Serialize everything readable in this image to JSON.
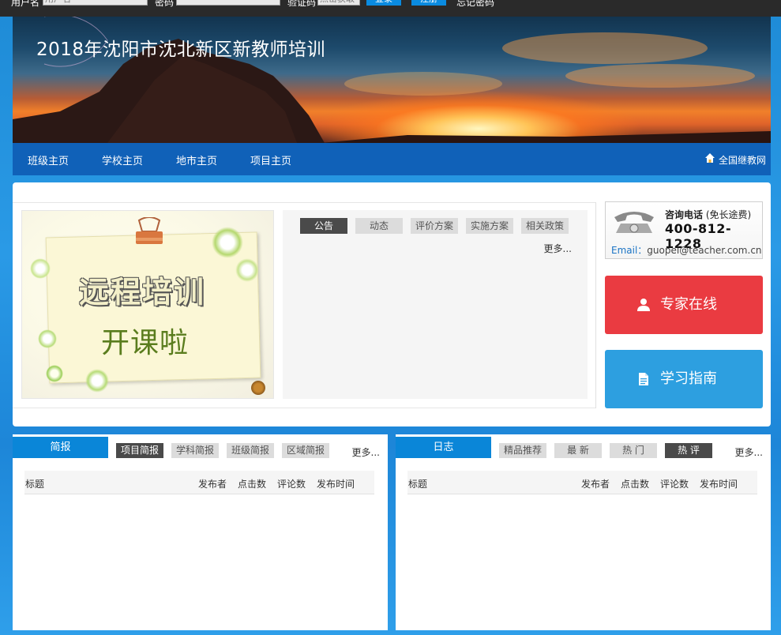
{
  "login": {
    "username_label": "用户名",
    "username_placeholder": "用户名",
    "password_label": "密码",
    "captcha_label": "验证码",
    "captcha_placeholder": "点击获取",
    "login_button": "登录",
    "register_button": "注册",
    "forgot_password": "忘记密码"
  },
  "banner": {
    "title": "2018年沈阳市沈北新区新教师培训"
  },
  "nav": {
    "items": [
      "班级主页",
      "学校主页",
      "地市主页",
      "项目主页"
    ],
    "right_link": "全国继教网"
  },
  "slide": {
    "line1": "远程培训",
    "line2": "开课啦"
  },
  "news": {
    "tabs": [
      "公告",
      "动态",
      "评价方案",
      "实施方案",
      "相关政策"
    ],
    "active_tab": 0,
    "more": "更多..."
  },
  "contact": {
    "label": "咨询电话",
    "note": "(免长途费)",
    "phone": "400-812-1228",
    "email_label": "Email：",
    "email": "guopei@teacher.com.cn"
  },
  "buttons": {
    "expert": "专家在线",
    "guide": "学习指南"
  },
  "panels": [
    {
      "title": "简报",
      "tabs": [
        "项目简报",
        "学科简报",
        "班级简报",
        "区域简报"
      ],
      "active_tab": 0,
      "more": "更多...",
      "columns": [
        "标题",
        "发布者",
        "点击数",
        "评论数",
        "发布时间"
      ]
    },
    {
      "title": "日志",
      "tabs": [
        "精品推荐",
        "最 新",
        "热 门",
        "热 评"
      ],
      "active_tab": 3,
      "more": "更多...",
      "columns": [
        "标题",
        "发布者",
        "点击数",
        "评论数",
        "发布时间"
      ]
    }
  ],
  "colors": {
    "nav_blue": "#1061b8",
    "title_blue": "#0a86d8",
    "expert_red": "#ea3b41",
    "guide_blue": "#2d9fe0",
    "tab_active": "#4a4a4a"
  }
}
